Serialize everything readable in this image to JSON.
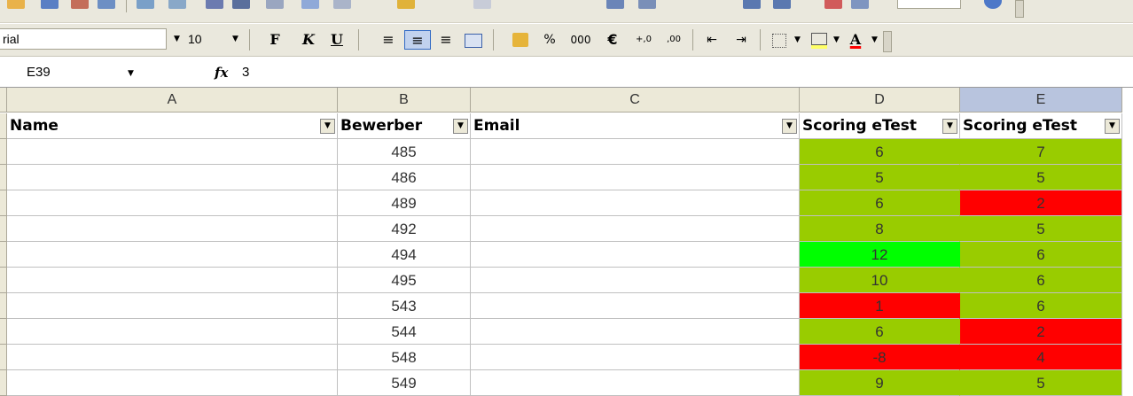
{
  "toolbar": {
    "font_name": "rial",
    "font_size": "10",
    "bold": "F",
    "italic": "K",
    "underline": "U",
    "percent": "%",
    "thousands": "000",
    "euro": "€",
    "inc_decimal": "+,0",
    "dec_decimal": ",00",
    "font_color": "A",
    "colors": {
      "fill_yellow": "#ffff66",
      "font_red": "#ff0000",
      "select_blue": "#316ac5"
    }
  },
  "formula_bar": {
    "cell_ref": "E39",
    "fx_label": "fx",
    "value": "3"
  },
  "columns": [
    "A",
    "B",
    "C",
    "D",
    "E"
  ],
  "headers": {
    "name": "Name",
    "bewerber": "Bewerber",
    "email": "Email",
    "scoring_d": "Scoring eTest",
    "scoring_e": "Scoring eTest"
  },
  "colors": {
    "olive_green": "#99cc00",
    "bright_green": "#00ff00",
    "red": "#ff0000"
  },
  "rows": [
    {
      "id": "485",
      "d": "6",
      "d_color": "#99cc00",
      "e": "7",
      "e_color": "#99cc00"
    },
    {
      "id": "486",
      "d": "5",
      "d_color": "#99cc00",
      "e": "5",
      "e_color": "#99cc00"
    },
    {
      "id": "489",
      "d": "6",
      "d_color": "#99cc00",
      "e": "2",
      "e_color": "#ff0000"
    },
    {
      "id": "492",
      "d": "8",
      "d_color": "#99cc00",
      "e": "5",
      "e_color": "#99cc00"
    },
    {
      "id": "494",
      "d": "12",
      "d_color": "#00ff00",
      "e": "6",
      "e_color": "#99cc00"
    },
    {
      "id": "495",
      "d": "10",
      "d_color": "#99cc00",
      "e": "6",
      "e_color": "#99cc00"
    },
    {
      "id": "543",
      "d": "1",
      "d_color": "#ff0000",
      "e": "6",
      "e_color": "#99cc00"
    },
    {
      "id": "544",
      "d": "6",
      "d_color": "#99cc00",
      "e": "2",
      "e_color": "#ff0000"
    },
    {
      "id": "548",
      "d": "-8",
      "d_color": "#ff0000",
      "e": "4",
      "e_color": "#ff0000"
    },
    {
      "id": "549",
      "d": "9",
      "d_color": "#99cc00",
      "e": "5",
      "e_color": "#99cc00"
    }
  ]
}
